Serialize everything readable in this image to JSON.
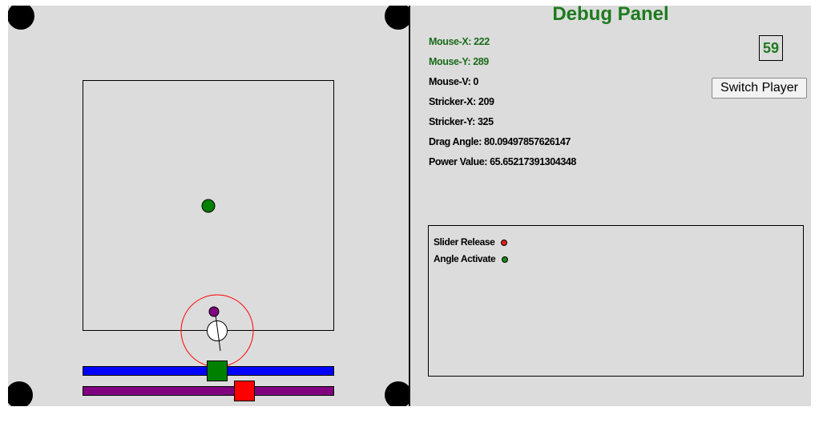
{
  "debug_panel": {
    "title": "Debug Panel",
    "fps": "59",
    "switch_player_label": "Switch Player",
    "stats": [
      {
        "text": "Mouse-X: 222"
      },
      {
        "text": "Mouse-Y: 289"
      },
      {
        "text": "Mouse-V: 0"
      },
      {
        "text": "Stricker-X: 209"
      },
      {
        "text": "Stricker-Y: 325"
      },
      {
        "text": "Drag Angle: 80.09497857626147"
      },
      {
        "text": "Power Value: 65.65217391304348"
      }
    ],
    "events": [
      {
        "label": "Slider Release",
        "color": "#e02020"
      },
      {
        "label": "Angle Activate",
        "color": "#1a8a1a"
      }
    ]
  },
  "colors": {
    "title_green": "#1e7a1e",
    "slider_blue": "#0000ff",
    "slider_purple": "#800080",
    "handle_green": "#008000",
    "handle_red": "#ff0000"
  }
}
